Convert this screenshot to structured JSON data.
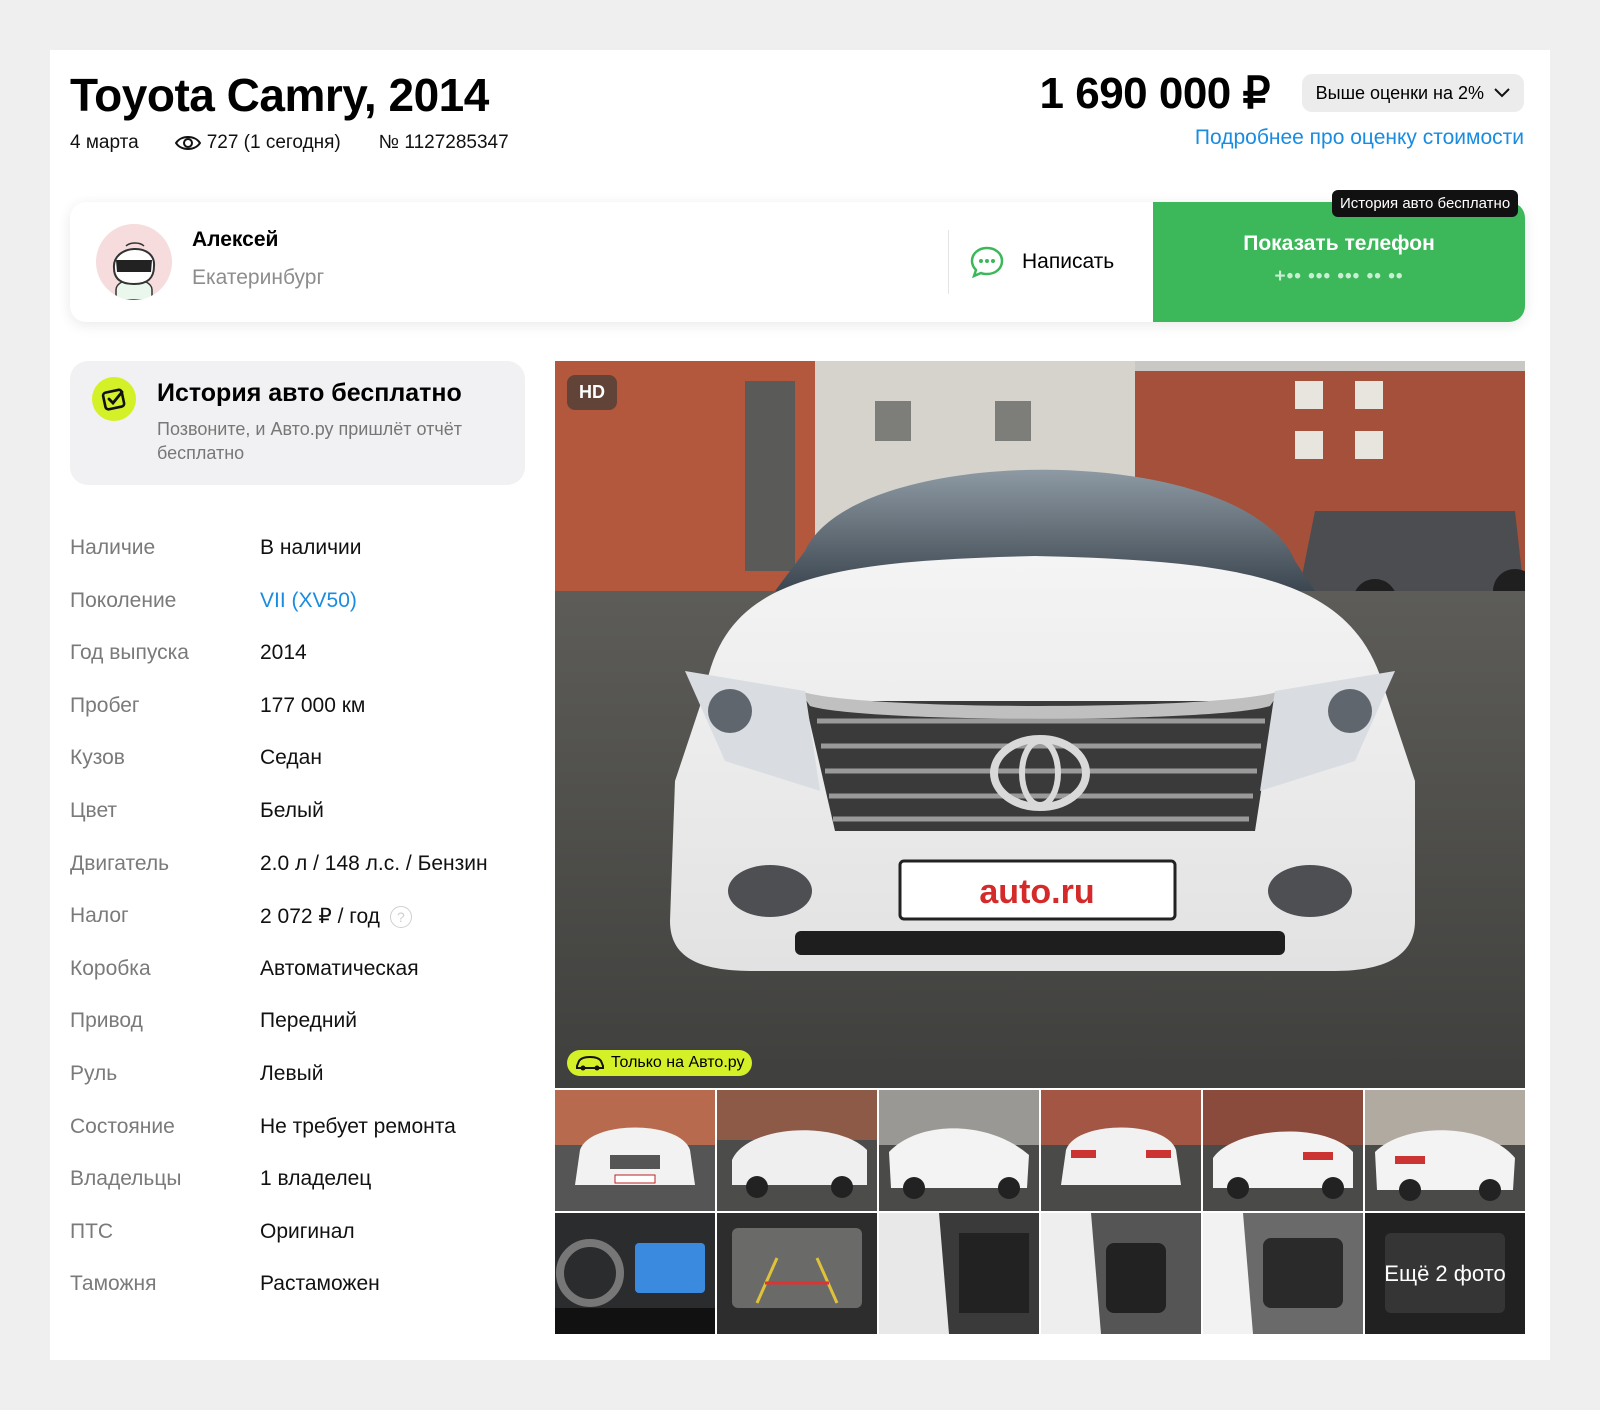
{
  "listing": {
    "title": "Toyota Camry, 2014",
    "date": "4 марта",
    "views": "727 (1 сегодня)",
    "number": "№ 1127285347",
    "price": "1 690 000 ₽",
    "estimate_chip": "Выше оценки на 2%",
    "estimate_link": "Подробнее про оценку стоимости"
  },
  "seller": {
    "name": "Алексей",
    "city": "Екатеринбург",
    "write_label": "Написать",
    "phone_label": "Показать телефон",
    "phone_mask": "+•• ••• ••• •• ••",
    "tooltip": "История авто бесплатно"
  },
  "history": {
    "title": "История авто бесплатно",
    "subtitle": "Позвоните, и Авто.ру пришлёт отчёт бесплатно"
  },
  "specs": [
    {
      "k": "Наличие",
      "v": "В наличии"
    },
    {
      "k": "Поколение",
      "v": "VII (XV50)"
    },
    {
      "k": "Год выпуска",
      "v": "2014"
    },
    {
      "k": "Пробег",
      "v": "177 000 км"
    },
    {
      "k": "Кузов",
      "v": "Седан"
    },
    {
      "k": "Цвет",
      "v": "Белый"
    },
    {
      "k": "Двигатель",
      "v": "2.0 л / 148 л.с. / Бензин"
    },
    {
      "k": "Налог",
      "v": "2 072 ₽ / год"
    },
    {
      "k": "Коробка",
      "v": "Автоматическая"
    },
    {
      "k": "Привод",
      "v": "Передний"
    },
    {
      "k": "Руль",
      "v": "Левый"
    },
    {
      "k": "Состояние",
      "v": "Не требует ремонта"
    },
    {
      "k": "Владельцы",
      "v": "1 владелец"
    },
    {
      "k": "ПТС",
      "v": "Оригинал"
    },
    {
      "k": "Таможня",
      "v": "Растаможен"
    }
  ],
  "gallery": {
    "hd_badge": "HD",
    "only_badge": "Только на Авто.ру",
    "plate_text": "auto.ru",
    "more_photos": "Ещё 2 фото"
  },
  "colors": {
    "accent_green": "#3cb75a",
    "link_blue": "#1a8ce0",
    "lime": "#d4f026"
  }
}
